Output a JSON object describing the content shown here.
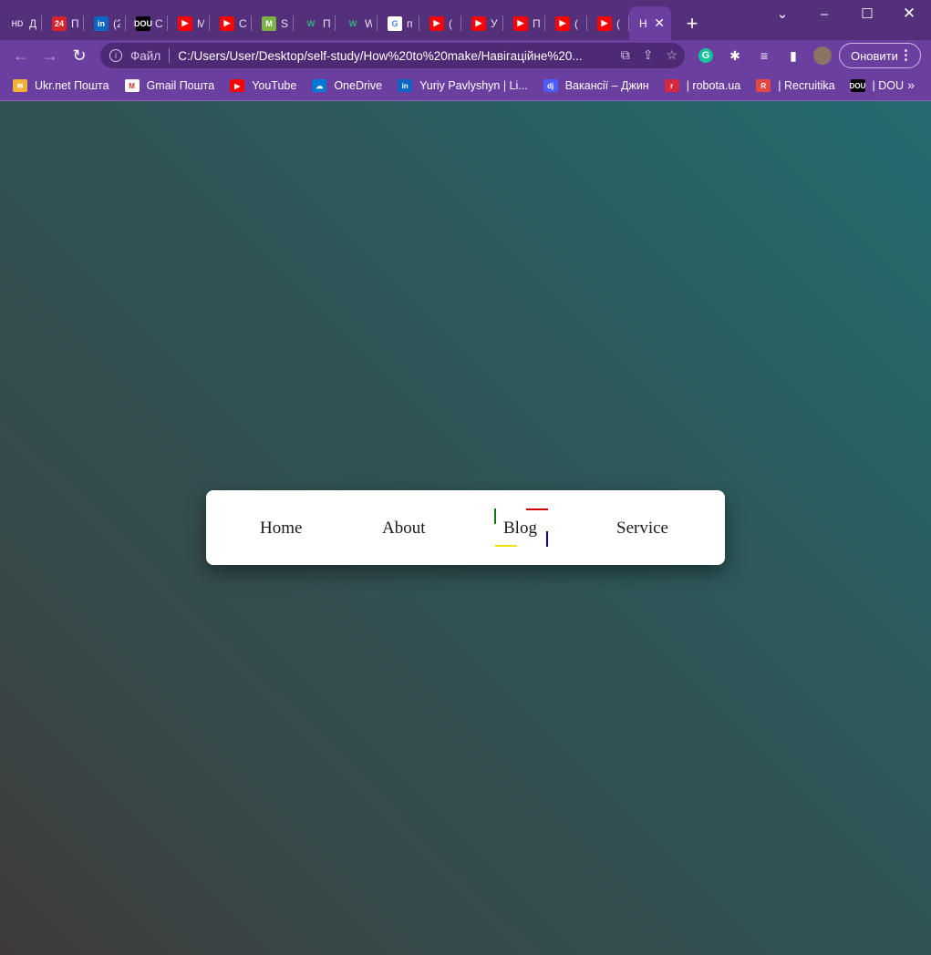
{
  "browser": {
    "tabs": [
      {
        "fav": "HD",
        "title": "Д",
        "fav_bg": "#55307a",
        "fav_color": "#cfc0e0"
      },
      {
        "fav": "24",
        "title": "П",
        "fav_bg": "#d8232a",
        "fav_color": "#ffffff"
      },
      {
        "fav": "in",
        "title": "(2",
        "fav_bg": "#0a66c2",
        "fav_color": "#ffffff"
      },
      {
        "fav": "DOU",
        "title": "С",
        "fav_bg": "#000000",
        "fav_color": "#ffffff"
      },
      {
        "fav": "▶",
        "title": "М",
        "fav_bg": "#ff0000",
        "fav_color": "#ffffff"
      },
      {
        "fav": "▶",
        "title": "С",
        "fav_bg": "#ff0000",
        "fav_color": "#ffffff"
      },
      {
        "fav": "M",
        "title": "S",
        "fav_bg": "#7cb342",
        "fav_color": "#ffffff"
      },
      {
        "fav": "W",
        "title": "П",
        "fav_bg": "#55307a",
        "fav_color": "#2bb673"
      },
      {
        "fav": "W",
        "title": "W",
        "fav_bg": "#55307a",
        "fav_color": "#2bb673"
      },
      {
        "fav": "G",
        "title": "п",
        "fav_bg": "#ffffff",
        "fav_color": "#4285f4"
      },
      {
        "fav": "▶",
        "title": "(",
        "fav_bg": "#ff0000",
        "fav_color": "#ffffff"
      },
      {
        "fav": "▶",
        "title": "У",
        "fav_bg": "#ff0000",
        "fav_color": "#ffffff"
      },
      {
        "fav": "▶",
        "title": "П",
        "fav_bg": "#ff0000",
        "fav_color": "#ffffff"
      },
      {
        "fav": "▶",
        "title": "(",
        "fav_bg": "#ff0000",
        "fav_color": "#ffffff"
      },
      {
        "fav": "▶",
        "title": "(",
        "fav_bg": "#ff0000",
        "fav_color": "#ffffff"
      }
    ],
    "active_tab": {
      "title": "Н",
      "close": "✕"
    },
    "new_tab": "+",
    "window_controls": {
      "minimize": "–",
      "maximize": "☐",
      "close": "✕",
      "tab_search": "⌄"
    },
    "omnibox": {
      "info": "i",
      "scheme_label": "Файл",
      "url": "C:/Users/User/Desktop/self-study/How%20to%20make/Навігаційне%20..."
    },
    "update_button": "Оновити",
    "bookmarks": [
      {
        "label": "Ukr.net Пошта",
        "icon": "ukrnet-icon",
        "bg": "#f2b233",
        "glyph": "✉"
      },
      {
        "label": "Gmail Пошта",
        "icon": "gmail-icon",
        "bg": "#ffffff",
        "glyph": "M"
      },
      {
        "label": "YouTube",
        "icon": "youtube-icon",
        "bg": "#ff0000",
        "glyph": "▶"
      },
      {
        "label": "OneDrive",
        "icon": "onedrive-icon",
        "bg": "#0078d4",
        "glyph": "☁"
      },
      {
        "label": "Yuriy Pavlyshyn | Li...",
        "icon": "linkedin-icon",
        "bg": "#0a66c2",
        "glyph": "in"
      },
      {
        "label": "Вакансії – Джин",
        "icon": "djinni-icon",
        "bg": "#4d5dfb",
        "glyph": "dj"
      },
      {
        "label": "| robota.ua",
        "icon": "robota-icon",
        "bg": "#d7263d",
        "glyph": "r"
      },
      {
        "label": "| Recruitika",
        "icon": "recruitika-icon",
        "bg": "#e8483f",
        "glyph": "R"
      },
      {
        "label": "| DOU",
        "icon": "dou-icon",
        "bg": "#000000",
        "glyph": "DOU"
      }
    ],
    "bookmarks_more": "»"
  },
  "navbar": {
    "links": [
      "Home",
      "About",
      "Blog",
      "Service"
    ],
    "active": "Blog",
    "accent_colors": {
      "top": "#d00000",
      "left": "#137a13",
      "right": "#0000c0",
      "bottom": "#f0e000"
    }
  }
}
